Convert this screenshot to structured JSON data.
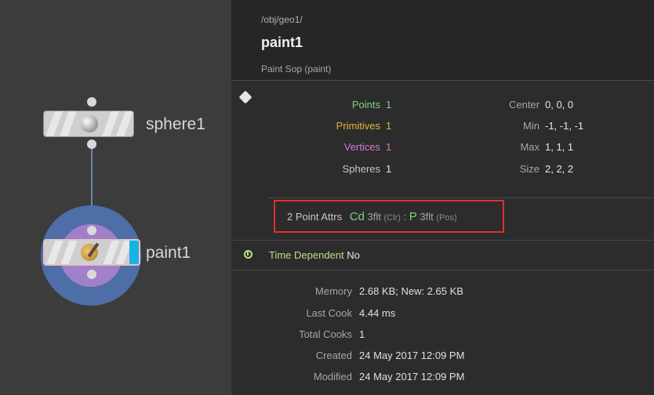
{
  "network": {
    "nodes": [
      {
        "name": "sphere1"
      },
      {
        "name": "paint1"
      }
    ]
  },
  "info": {
    "path": "/obj/geo1/",
    "title": "paint1",
    "subtitle": "Paint Sop (paint)",
    "counts": [
      {
        "label": "Points",
        "value": "1",
        "color": "#7fd07f"
      },
      {
        "label": "Primitives",
        "value": "1",
        "color": "#e0b43c"
      },
      {
        "label": "Vertices",
        "value": "1",
        "color": "#d27ad2"
      },
      {
        "label": "Spheres",
        "value": "1",
        "color": "#c8c8c8"
      }
    ],
    "bounds": [
      {
        "label": "Center",
        "value": "0, 0, 0"
      },
      {
        "label": "Min",
        "value": "-1, -1, -1"
      },
      {
        "label": "Max",
        "value": "1, 1, 1"
      },
      {
        "label": "Size",
        "value": "2, 2, 2"
      }
    ],
    "point_attrs": {
      "label": "2 Point Attrs",
      "attr1_name": "Cd",
      "attr1_type": "3flt",
      "attr1_desc": "(Clr)",
      "separator": ":",
      "attr2_name": "P",
      "attr2_type": "3flt",
      "attr2_desc": "(Pos)"
    },
    "time_dependent": {
      "label": "Time Dependent",
      "value": "No"
    },
    "meta": [
      {
        "label": "Memory",
        "value": "2.68 KB; New: 2.65 KB"
      },
      {
        "label": "Last Cook",
        "value": "4.44 ms"
      },
      {
        "label": "Total Cooks",
        "value": "1"
      },
      {
        "label": "Created",
        "value": "24 May 2017 12:09 PM"
      },
      {
        "label": "Modified",
        "value": "24 May 2017 12:09 PM"
      }
    ]
  },
  "colors": {
    "attr_green": "#7fd07f",
    "highlight_box": "#e03030",
    "wire": "#6f87a8",
    "display_flag": "#17b3e6"
  }
}
